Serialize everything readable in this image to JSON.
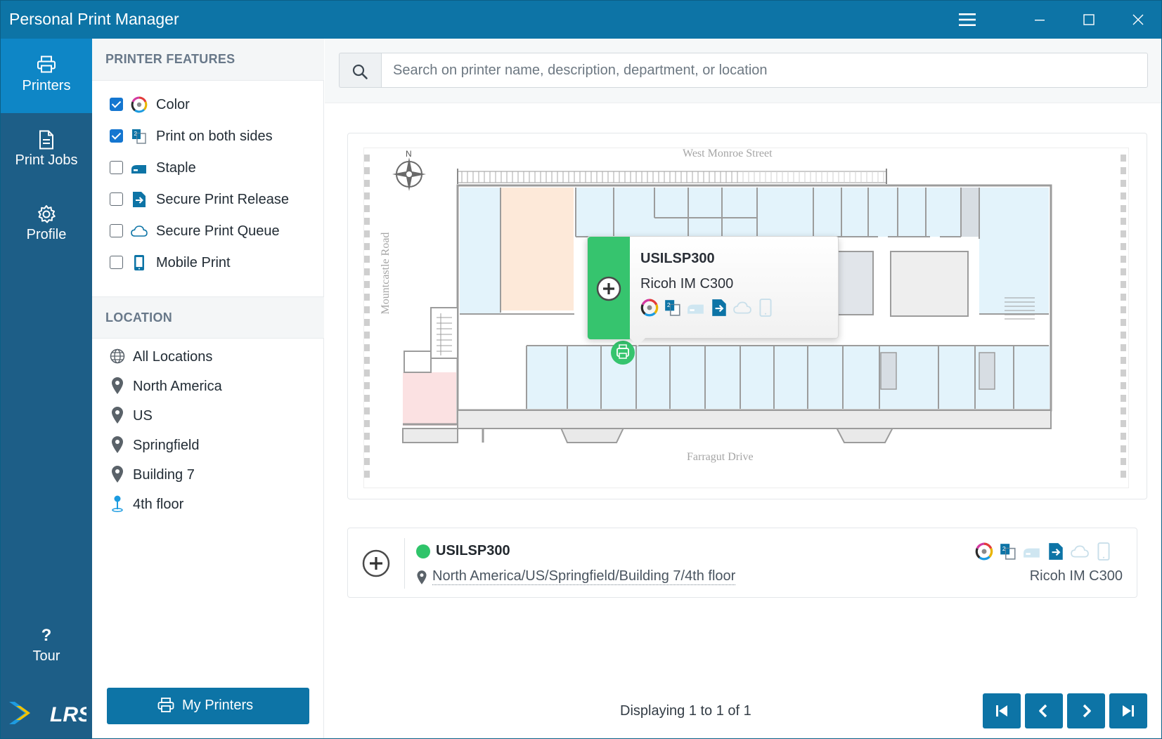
{
  "window": {
    "title": "Personal Print Manager",
    "controls": {
      "menu_icon": "hamburger-icon",
      "minimize_icon": "minimize-icon",
      "maximize_icon": "maximize-icon",
      "close_icon": "close-icon"
    }
  },
  "nav": {
    "items": [
      {
        "label": "Printers",
        "icon": "printer-icon",
        "active": true
      },
      {
        "label": "Print Jobs",
        "icon": "document-icon",
        "active": false
      },
      {
        "label": "Profile",
        "icon": "gear-icon",
        "active": false
      }
    ],
    "tour": {
      "symbol": "?",
      "label": "Tour"
    },
    "logo_text": "LRS"
  },
  "filters": {
    "features_heading": "PRINTER FEATURES",
    "features": [
      {
        "label": "Color",
        "checked": true,
        "icon": "color-wheel-icon"
      },
      {
        "label": "Print on both sides",
        "checked": true,
        "icon": "duplex-icon"
      },
      {
        "label": "Staple",
        "checked": false,
        "icon": "stapler-icon"
      },
      {
        "label": "Secure Print Release",
        "checked": false,
        "icon": "secure-release-icon"
      },
      {
        "label": "Secure Print Queue",
        "checked": false,
        "icon": "cloud-icon"
      },
      {
        "label": "Mobile Print",
        "checked": false,
        "icon": "mobile-icon"
      }
    ],
    "location_heading": "LOCATION",
    "locations": [
      {
        "label": "All Locations",
        "icon": "globe-icon"
      },
      {
        "label": "North America",
        "icon": "map-pin-icon"
      },
      {
        "label": "US",
        "icon": "map-pin-icon"
      },
      {
        "label": "Springfield",
        "icon": "map-pin-icon"
      },
      {
        "label": "Building 7",
        "icon": "map-pin-icon"
      },
      {
        "label": "4th floor",
        "icon": "floor-pin-icon"
      }
    ],
    "my_printers_label": "My Printers"
  },
  "search": {
    "placeholder": "Search on printer name, description, department, or location",
    "value": ""
  },
  "map": {
    "compass": "N",
    "streets": {
      "north": "West Monroe Street",
      "west": "Mountcastle Road",
      "south": "Farragut Drive"
    },
    "popup": {
      "name": "USILSP300",
      "model": "Ricoh IM C300",
      "status_color": "#36c46e"
    }
  },
  "results": [
    {
      "name": "USILSP300",
      "status": "online",
      "status_color": "#2fc46a",
      "location": "North America/US/Springfield/Building 7/4th floor",
      "model": "Ricoh IM C300",
      "features": [
        "color-wheel-icon",
        "duplex-icon",
        "stapler-icon",
        "secure-release-icon",
        "cloud-icon",
        "mobile-icon"
      ]
    }
  ],
  "pagination": {
    "text": "Displaying 1 to 1 of 1"
  },
  "colors": {
    "titlebar": "#0d74a6",
    "nav": "#1d5e87",
    "nav_active": "#0e86c6",
    "accent": "#1476d0"
  }
}
